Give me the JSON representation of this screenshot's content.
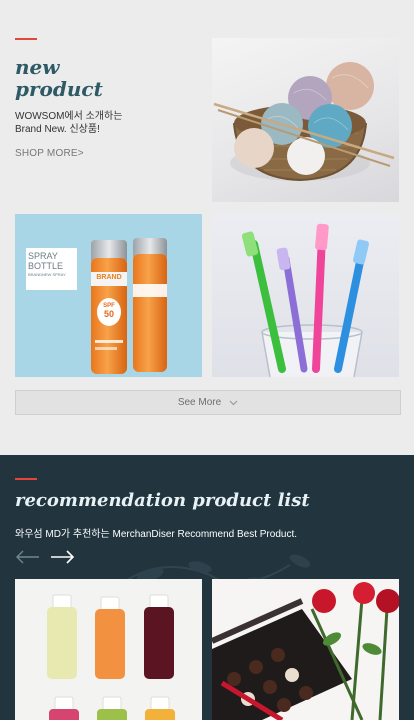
{
  "colors": {
    "accent": "#e2473a",
    "teal": "#2e5a66",
    "rec_bg": "#22353f"
  },
  "new_product": {
    "heading_line1": "new",
    "heading_line2": "product",
    "desc_line1": "WOWSOM에서 소개하는",
    "desc_line2": "Brand New. 신상품!",
    "shop_more": "SHOP MORE>",
    "see_more": "See More",
    "see_more_icon": "chevron-down-icon",
    "spray_label_line1": "SPRAY",
    "spray_label_line2": "BOTTLE",
    "spray_label_line3": "BRANDNEW SPRAY",
    "spray_brand": "BRAND",
    "spray_spf": "SPF",
    "spray_spf_num": "50"
  },
  "recommendation": {
    "heading": "recommendation product list",
    "desc": "와우섬 MD가 추천하는 MerchanDiser Recommend Best Product.",
    "prev_icon": "arrow-left-icon",
    "next_icon": "arrow-right-icon"
  }
}
